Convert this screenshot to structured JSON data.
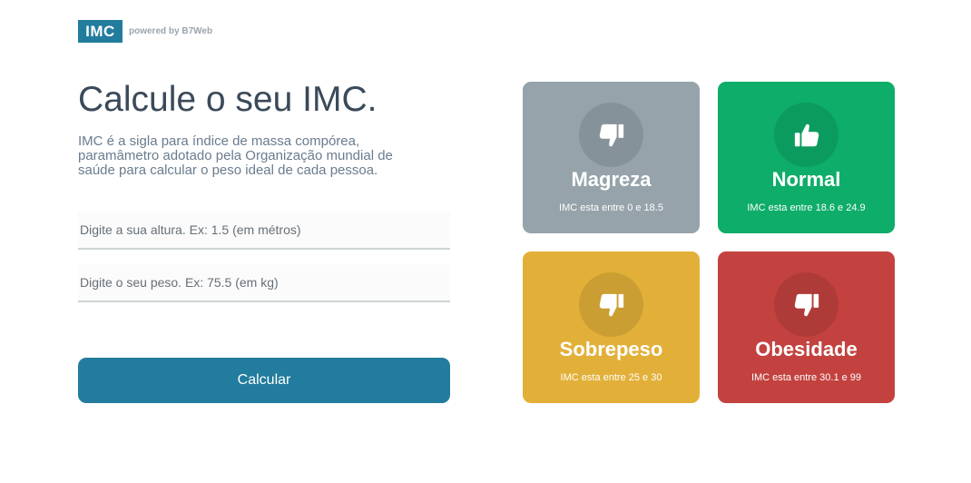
{
  "logo": {
    "brand": "IMC",
    "tagline": "powered by B7Web"
  },
  "main": {
    "title": "Calcule o seu IMC.",
    "description": "IMC é a sigla para índice de massa compórea, paramâmetro adotado pela Organização mundial de saúde para calcular o peso ideal de cada pessoa."
  },
  "form": {
    "height_placeholder": "Digite a sua altura. Ex: 1.5 (em métros)",
    "height_value": "",
    "weight_placeholder": "Digite o seu peso. Ex: 75.5 (em kg)",
    "weight_value": "",
    "calculate_label": "Calcular"
  },
  "cards": [
    {
      "title": "Magreza",
      "range": "IMC esta entre 0 e 18.5",
      "color": "#96a3ab",
      "icon": "thumbs-down-icon"
    },
    {
      "title": "Normal",
      "range": "IMC esta entre 18.6 e 24.9",
      "color": "#0ead69",
      "icon": "thumbs-up-icon"
    },
    {
      "title": "Sobrepeso",
      "range": "IMC esta entre 25 e 30",
      "color": "#e2b039",
      "icon": "thumbs-down-icon"
    },
    {
      "title": "Obesidade",
      "range": "IMC esta entre 30.1 e 99",
      "color": "#c3423f",
      "icon": "thumbs-down-icon"
    }
  ],
  "colors": {
    "accent": "#227c9d",
    "title_text": "#3a4a5a",
    "description_text": "#6a7c8e"
  }
}
